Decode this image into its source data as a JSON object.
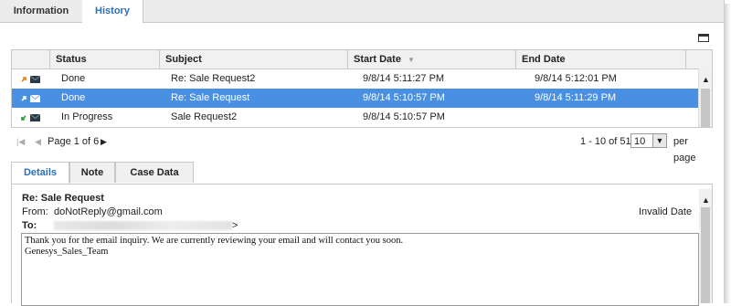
{
  "top_tabs": [
    "Information",
    "History"
  ],
  "history": {
    "columns": [
      "Status",
      "Subject",
      "Start Date",
      "End Date"
    ],
    "rows": [
      {
        "status": "Done",
        "subject": "Re: Sale Request2",
        "start": "9/8/14 5:11:27 PM",
        "end": "9/8/14 5:12:01 PM",
        "icon": "reply-email-icon"
      },
      {
        "status": "Done",
        "subject": "Re: Sale Request",
        "start": "9/8/14 5:10:57 PM",
        "end": "9/8/14 5:11:29 PM",
        "icon": "reply-email-icon"
      },
      {
        "status": "In Progress",
        "subject": "Sale Request2",
        "start": "9/8/14 5:10:57 PM",
        "end": "",
        "icon": "inbound-email-icon"
      }
    ],
    "selected_row": 1
  },
  "pager": {
    "page_text": "Page 1 of 6",
    "range_text": "1 - 10 of 51",
    "page_size": "10",
    "per_page": "per page"
  },
  "detail_tabs": [
    "Details",
    "Note",
    "Case Data"
  ],
  "detail": {
    "subject": "Re: Sale Request",
    "from_label": "From:",
    "from_value": "doNotReply@gmail.com",
    "status": "Invalid Date",
    "to_label": "To:",
    "to_end": ">",
    "body_line1": "Thank you for the email inquiry. We are currently reviewing your email and will contact you soon.",
    "body_line2": "Genesys_Sales_Team"
  },
  "colors": {
    "selection": "#4a90e2",
    "tab_active_text": "#2d6fb7"
  }
}
